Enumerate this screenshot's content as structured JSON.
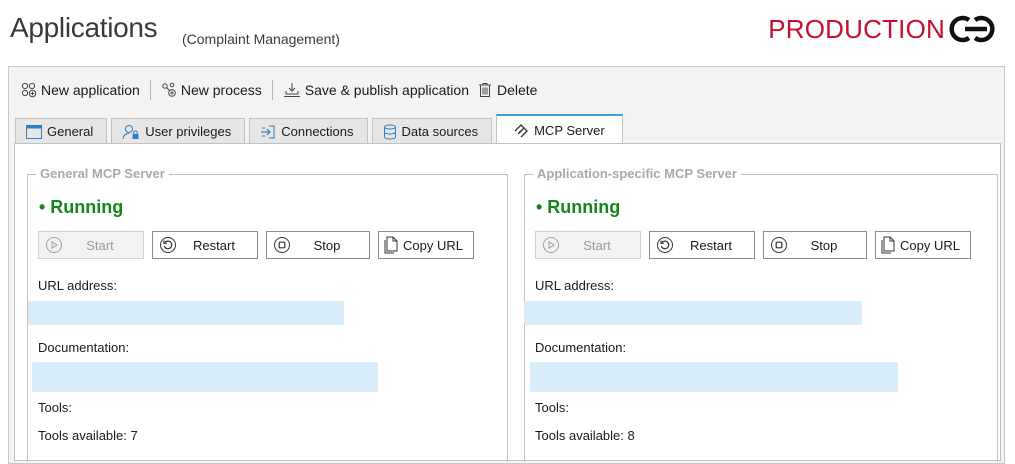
{
  "header": {
    "title": "Applications",
    "subtitle": "(Complaint Management)",
    "environment": "PRODUCTION",
    "logo_icon": "connected-rings-logo"
  },
  "toolbar": {
    "new_application": "New application",
    "new_process": "New process",
    "save_publish": "Save & publish application",
    "delete": "Delete"
  },
  "tabs": [
    {
      "label": "General",
      "icon": "window-icon"
    },
    {
      "label": "User privileges",
      "icon": "user-lock-icon"
    },
    {
      "label": "Connections",
      "icon": "connection-icon"
    },
    {
      "label": "Data sources",
      "icon": "database-icon"
    },
    {
      "label": "MCP Server",
      "icon": "mcp-icon",
      "active": true
    }
  ],
  "colors": {
    "accent": "#35a2dc",
    "running": "#16851f",
    "production": "#c8102e",
    "url_highlight": "#d9ecfa"
  },
  "general_mcp": {
    "legend": "General MCP Server",
    "status": "• Running",
    "buttons": {
      "start": "Start",
      "restart": "Restart",
      "stop": "Stop",
      "copy_url": "Copy URL"
    },
    "url_label": "URL address:",
    "documentation_label": "Documentation:",
    "tools_label": "Tools:",
    "tools_available": "Tools available: 7"
  },
  "app_mcp": {
    "legend": "Application-specific MCP Server",
    "status": "• Running",
    "buttons": {
      "start": "Start",
      "restart": "Restart",
      "stop": "Stop",
      "copy_url": "Copy URL"
    },
    "url_label": "URL address:",
    "documentation_label": "Documentation:",
    "tools_label": "Tools:",
    "tools_available": "Tools available: 8"
  }
}
